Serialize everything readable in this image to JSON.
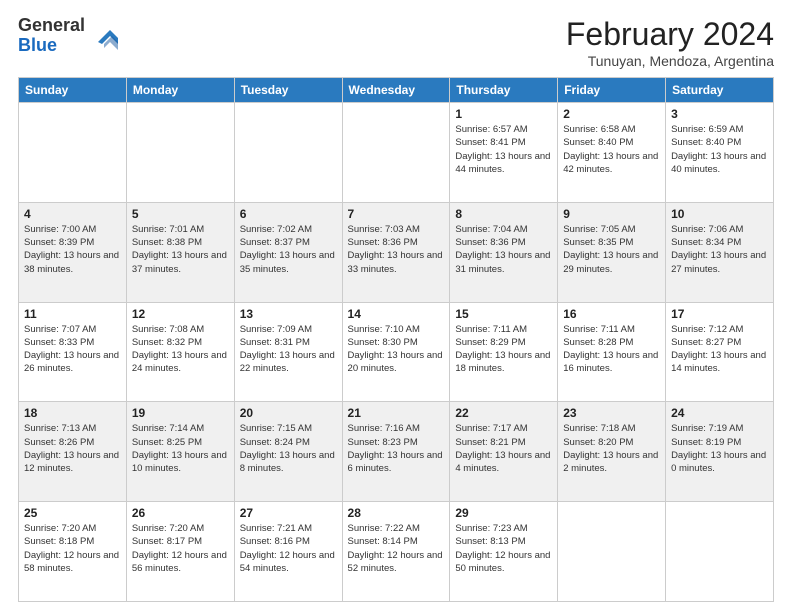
{
  "logo": {
    "general": "General",
    "blue": "Blue"
  },
  "header": {
    "title": "February 2024",
    "subtitle": "Tunuyan, Mendoza, Argentina"
  },
  "days_of_week": [
    "Sunday",
    "Monday",
    "Tuesday",
    "Wednesday",
    "Thursday",
    "Friday",
    "Saturday"
  ],
  "weeks": [
    [
      {
        "day": "",
        "info": ""
      },
      {
        "day": "",
        "info": ""
      },
      {
        "day": "",
        "info": ""
      },
      {
        "day": "",
        "info": ""
      },
      {
        "day": "1",
        "info": "Sunrise: 6:57 AM\nSunset: 8:41 PM\nDaylight: 13 hours and 44 minutes."
      },
      {
        "day": "2",
        "info": "Sunrise: 6:58 AM\nSunset: 8:40 PM\nDaylight: 13 hours and 42 minutes."
      },
      {
        "day": "3",
        "info": "Sunrise: 6:59 AM\nSunset: 8:40 PM\nDaylight: 13 hours and 40 minutes."
      }
    ],
    [
      {
        "day": "4",
        "info": "Sunrise: 7:00 AM\nSunset: 8:39 PM\nDaylight: 13 hours and 38 minutes."
      },
      {
        "day": "5",
        "info": "Sunrise: 7:01 AM\nSunset: 8:38 PM\nDaylight: 13 hours and 37 minutes."
      },
      {
        "day": "6",
        "info": "Sunrise: 7:02 AM\nSunset: 8:37 PM\nDaylight: 13 hours and 35 minutes."
      },
      {
        "day": "7",
        "info": "Sunrise: 7:03 AM\nSunset: 8:36 PM\nDaylight: 13 hours and 33 minutes."
      },
      {
        "day": "8",
        "info": "Sunrise: 7:04 AM\nSunset: 8:36 PM\nDaylight: 13 hours and 31 minutes."
      },
      {
        "day": "9",
        "info": "Sunrise: 7:05 AM\nSunset: 8:35 PM\nDaylight: 13 hours and 29 minutes."
      },
      {
        "day": "10",
        "info": "Sunrise: 7:06 AM\nSunset: 8:34 PM\nDaylight: 13 hours and 27 minutes."
      }
    ],
    [
      {
        "day": "11",
        "info": "Sunrise: 7:07 AM\nSunset: 8:33 PM\nDaylight: 13 hours and 26 minutes."
      },
      {
        "day": "12",
        "info": "Sunrise: 7:08 AM\nSunset: 8:32 PM\nDaylight: 13 hours and 24 minutes."
      },
      {
        "day": "13",
        "info": "Sunrise: 7:09 AM\nSunset: 8:31 PM\nDaylight: 13 hours and 22 minutes."
      },
      {
        "day": "14",
        "info": "Sunrise: 7:10 AM\nSunset: 8:30 PM\nDaylight: 13 hours and 20 minutes."
      },
      {
        "day": "15",
        "info": "Sunrise: 7:11 AM\nSunset: 8:29 PM\nDaylight: 13 hours and 18 minutes."
      },
      {
        "day": "16",
        "info": "Sunrise: 7:11 AM\nSunset: 8:28 PM\nDaylight: 13 hours and 16 minutes."
      },
      {
        "day": "17",
        "info": "Sunrise: 7:12 AM\nSunset: 8:27 PM\nDaylight: 13 hours and 14 minutes."
      }
    ],
    [
      {
        "day": "18",
        "info": "Sunrise: 7:13 AM\nSunset: 8:26 PM\nDaylight: 13 hours and 12 minutes."
      },
      {
        "day": "19",
        "info": "Sunrise: 7:14 AM\nSunset: 8:25 PM\nDaylight: 13 hours and 10 minutes."
      },
      {
        "day": "20",
        "info": "Sunrise: 7:15 AM\nSunset: 8:24 PM\nDaylight: 13 hours and 8 minutes."
      },
      {
        "day": "21",
        "info": "Sunrise: 7:16 AM\nSunset: 8:23 PM\nDaylight: 13 hours and 6 minutes."
      },
      {
        "day": "22",
        "info": "Sunrise: 7:17 AM\nSunset: 8:21 PM\nDaylight: 13 hours and 4 minutes."
      },
      {
        "day": "23",
        "info": "Sunrise: 7:18 AM\nSunset: 8:20 PM\nDaylight: 13 hours and 2 minutes."
      },
      {
        "day": "24",
        "info": "Sunrise: 7:19 AM\nSunset: 8:19 PM\nDaylight: 13 hours and 0 minutes."
      }
    ],
    [
      {
        "day": "25",
        "info": "Sunrise: 7:20 AM\nSunset: 8:18 PM\nDaylight: 12 hours and 58 minutes."
      },
      {
        "day": "26",
        "info": "Sunrise: 7:20 AM\nSunset: 8:17 PM\nDaylight: 12 hours and 56 minutes."
      },
      {
        "day": "27",
        "info": "Sunrise: 7:21 AM\nSunset: 8:16 PM\nDaylight: 12 hours and 54 minutes."
      },
      {
        "day": "28",
        "info": "Sunrise: 7:22 AM\nSunset: 8:14 PM\nDaylight: 12 hours and 52 minutes."
      },
      {
        "day": "29",
        "info": "Sunrise: 7:23 AM\nSunset: 8:13 PM\nDaylight: 12 hours and 50 minutes."
      },
      {
        "day": "",
        "info": ""
      },
      {
        "day": "",
        "info": ""
      }
    ]
  ]
}
